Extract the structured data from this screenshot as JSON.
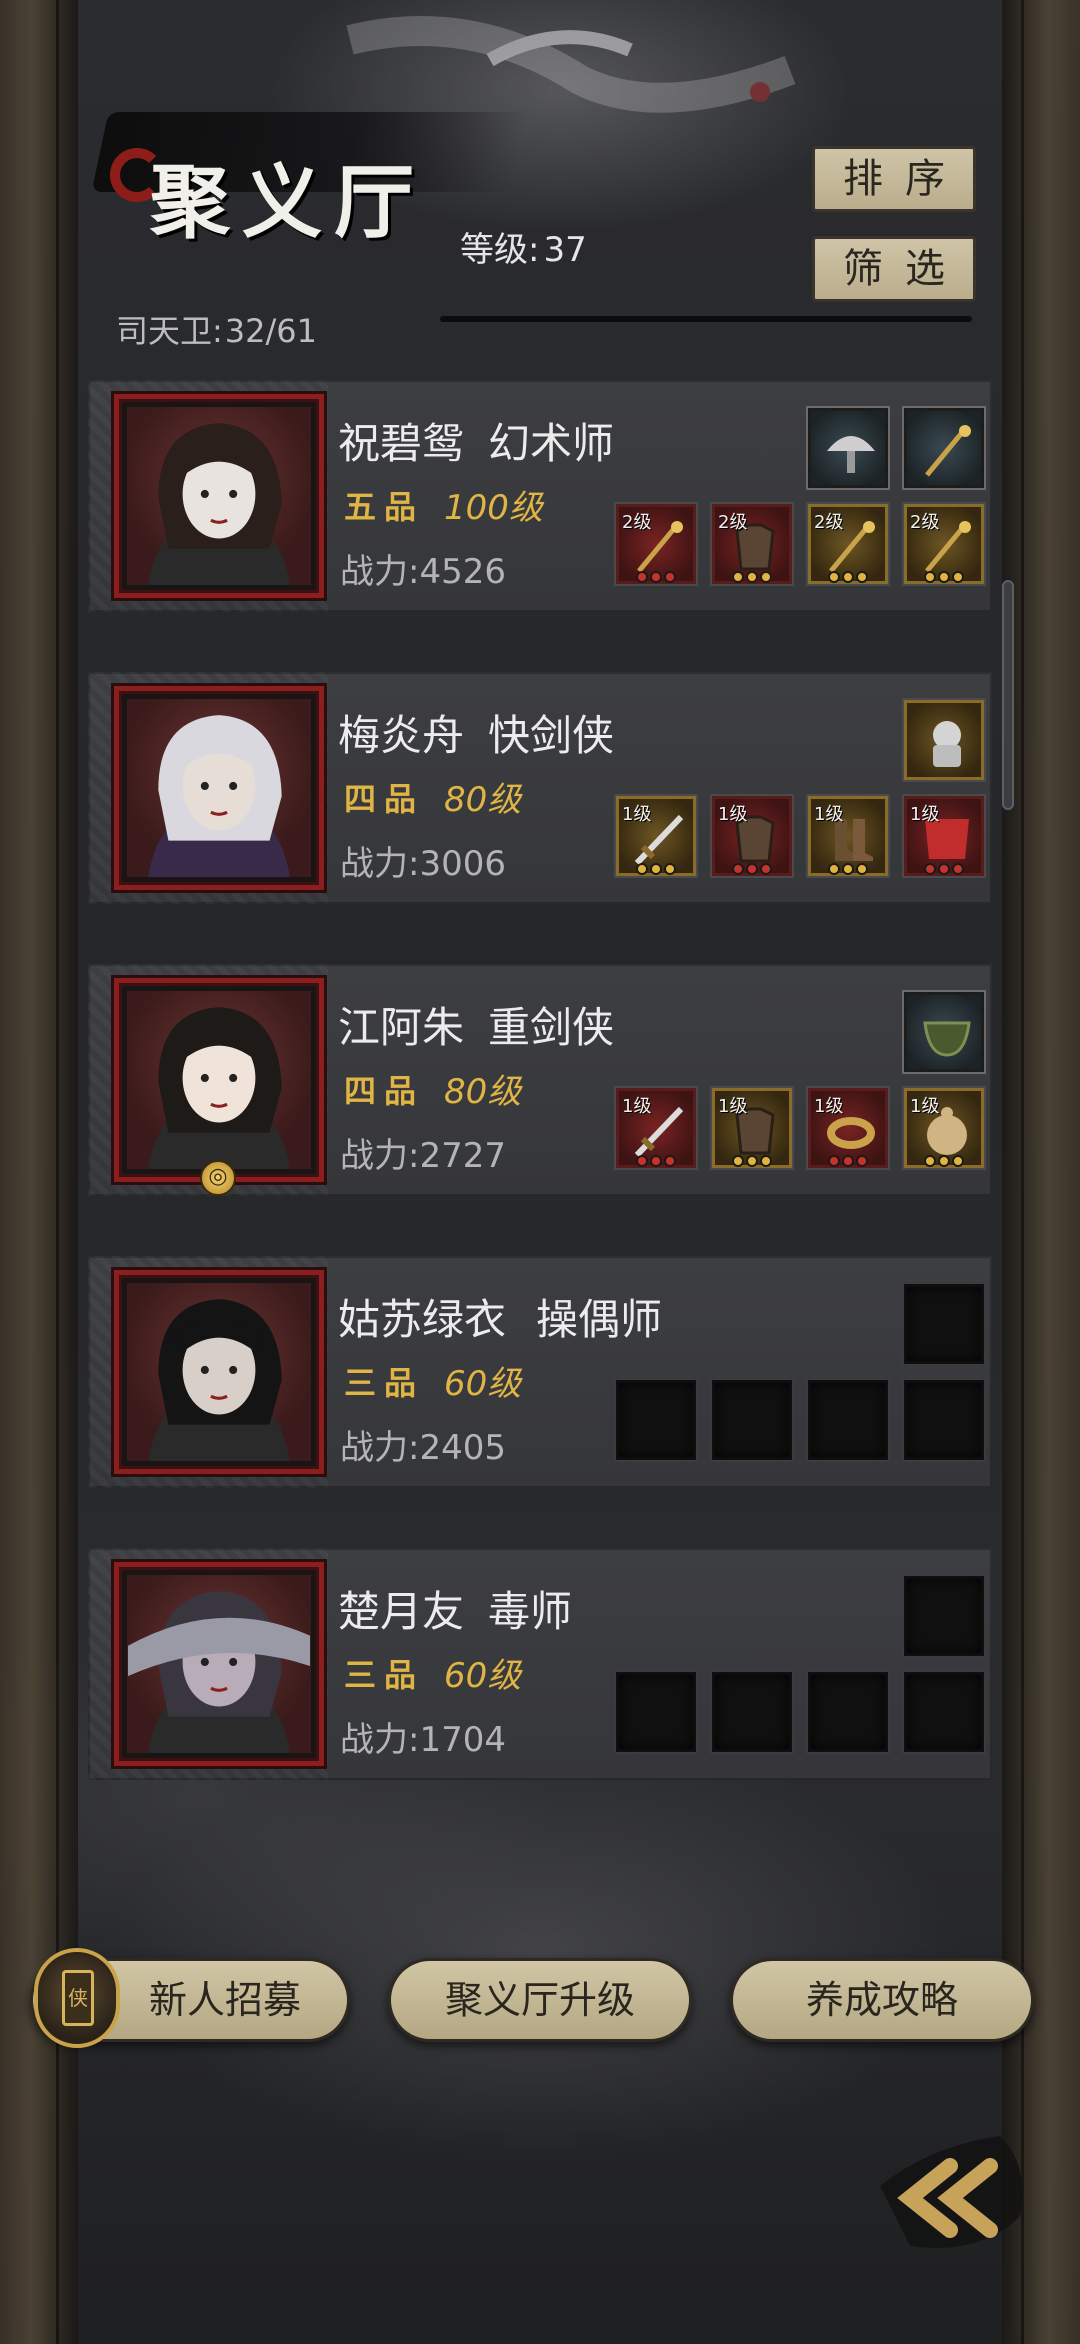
{
  "header": {
    "title": "聚义厅",
    "level_label": "等级:",
    "level_value": "37",
    "guard_label": "司天卫:",
    "guard_value": "32/61",
    "sort_label": "排序",
    "filter_label": "筛选"
  },
  "heroes": [
    {
      "name": "祝碧鸳",
      "class": "幻术师",
      "grade": "五品",
      "level": "100级",
      "power_label": "战力:",
      "power": "4526",
      "top_slots": [
        {
          "type": "blue",
          "icon": "mushroom-icon"
        },
        {
          "type": "blue",
          "icon": "staff-icon"
        }
      ],
      "slots": [
        {
          "type": "red",
          "lv": "2级",
          "icon": "spear-icon",
          "gem": "#c8322d"
        },
        {
          "type": "red",
          "lv": "2级",
          "icon": "armor-icon",
          "gem": "#e2b33d"
        },
        {
          "type": "gold",
          "lv": "2级",
          "icon": "staff-icon",
          "gem": "#e2b33d"
        },
        {
          "type": "gold",
          "lv": "2级",
          "icon": "staff-icon",
          "gem": "#e2b33d"
        }
      ]
    },
    {
      "name": "梅炎舟",
      "class": "快剑侠",
      "grade": "四品",
      "level": "80级",
      "power_label": "战力:",
      "power": "3006",
      "top_slots": [
        {
          "type": "gold",
          "icon": "lion-statue-icon"
        }
      ],
      "slots": [
        {
          "type": "gold",
          "lv": "1级",
          "icon": "sword-icon",
          "gem": "#e2b33d"
        },
        {
          "type": "red",
          "lv": "1级",
          "icon": "armor-icon",
          "gem": "#c8322d"
        },
        {
          "type": "gold",
          "lv": "1级",
          "icon": "boots-icon",
          "gem": "#e2b33d"
        },
        {
          "type": "red",
          "lv": "1级",
          "icon": "cloth-icon",
          "gem": "#c8322d"
        }
      ]
    },
    {
      "name": "江阿朱",
      "class": "重剑侠",
      "grade": "四品",
      "level": "80级",
      "power_label": "战力:",
      "power": "2727",
      "top_slots": [
        {
          "type": "blue",
          "icon": "bowl-icon"
        }
      ],
      "slots": [
        {
          "type": "red",
          "lv": "1级",
          "icon": "sword-icon",
          "gem": "#c8322d"
        },
        {
          "type": "gold",
          "lv": "1级",
          "icon": "armor-icon",
          "gem": "#e2b33d"
        },
        {
          "type": "red",
          "lv": "1级",
          "icon": "ring-icon",
          "gem": "#c8322d"
        },
        {
          "type": "gold",
          "lv": "1级",
          "icon": "pouch-icon",
          "gem": "#e2b33d"
        }
      ]
    },
    {
      "name": "姑苏绿衣",
      "class": "操偶师",
      "grade": "三品",
      "level": "60级",
      "power_label": "战力:",
      "power": "2405",
      "top_slots": [
        {
          "type": "empty"
        }
      ],
      "slots": [
        {
          "type": "empty"
        },
        {
          "type": "empty"
        },
        {
          "type": "empty"
        },
        {
          "type": "empty"
        }
      ]
    },
    {
      "name": "楚月友",
      "class": "毒师",
      "grade": "三品",
      "level": "60级",
      "power_label": "战力:",
      "power": "1704",
      "top_slots": [
        {
          "type": "empty"
        }
      ],
      "slots": [
        {
          "type": "empty"
        },
        {
          "type": "empty"
        },
        {
          "type": "empty"
        },
        {
          "type": "empty"
        }
      ]
    }
  ],
  "footer": {
    "recruit_label": "新人招募",
    "upgrade_label": "聚义厅升级",
    "guide_label": "养成攻略",
    "recruit_icon_char": "侠"
  },
  "colors": {
    "grade_gold": "#e0b445",
    "frame_red": "#8b1f1f",
    "button_beige": "#cfc4a6"
  }
}
